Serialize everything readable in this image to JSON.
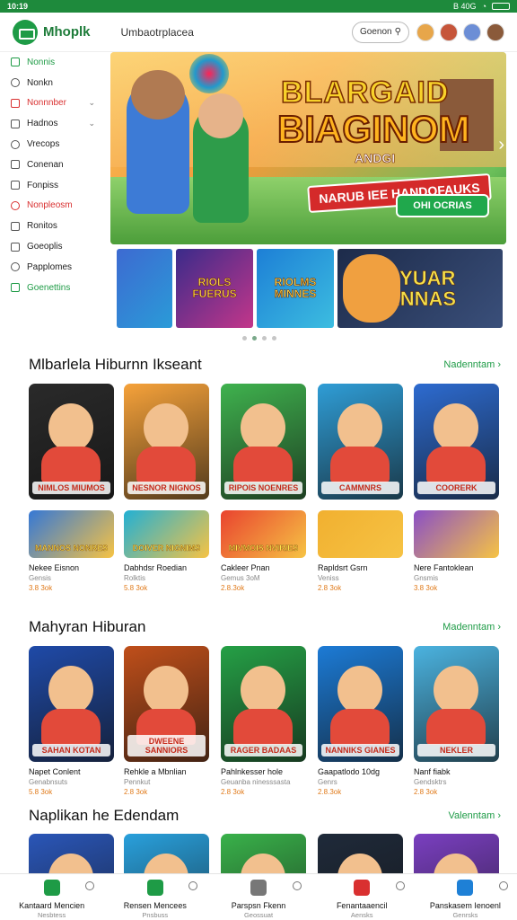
{
  "status_bar": {
    "time": "10:19",
    "right_text": "B 40G"
  },
  "header": {
    "app_name": "Mhoplk",
    "tagline": "Umbaotrplacea",
    "search_placeholder": "Goenon"
  },
  "sidebar": {
    "items": [
      {
        "label": "Nonnis",
        "style": "green",
        "icon": "grid-icon"
      },
      {
        "label": "Nonkn",
        "style": "normal",
        "icon": "calendar-icon"
      },
      {
        "label": "Nonnnber",
        "style": "red",
        "icon": "tag-icon",
        "chevron": true
      },
      {
        "label": "Hadnos",
        "style": "normal",
        "icon": "list-icon",
        "chevron": true
      },
      {
        "label": "Vrecops",
        "style": "normal",
        "icon": "doc-icon"
      },
      {
        "label": "Conenan",
        "style": "normal",
        "icon": "check-icon"
      },
      {
        "label": "Fonpiss",
        "style": "normal",
        "icon": "refresh-icon"
      },
      {
        "label": "Nonpleosm",
        "style": "red",
        "icon": "clock-icon"
      },
      {
        "label": "Ronitos",
        "style": "normal",
        "icon": "settings-icon"
      },
      {
        "label": "Goeoplis",
        "style": "normal",
        "icon": "globe-icon"
      },
      {
        "label": "Papplomes",
        "style": "normal",
        "icon": "message-icon"
      },
      {
        "label": "Goenettins",
        "style": "green",
        "icon": "file-icon"
      }
    ]
  },
  "hero": {
    "title_line1": "BLARGAID",
    "title_line2": "BIAGINOM",
    "title_line3": "ANDGI",
    "banner_text": "NARUB IEE HANDOFAUKS",
    "cta_label": "OHI OCRIAS"
  },
  "mini_banners": [
    "",
    "RIOLS FUERUS",
    "RIOLMS MINNES",
    "SHYUAR CANNAS"
  ],
  "sections": [
    {
      "title": "Mlbarlela Hiburnn Ikseant",
      "more_label": "Nadenntam",
      "cards": [
        {
          "big_label": "NIMLOS MIUMOS",
          "small_label": "MANNOS NONRES",
          "name": "Nekee Eisnon",
          "sub": "Gensis",
          "rating": "3.8 3ok",
          "big_color": "#2a2a2a",
          "small_color": "#3578d6"
        },
        {
          "big_label": "NESNOR NIGNOS",
          "small_label": "DOIVER NIGNIMS",
          "name": "Dabhdsr Roedian",
          "sub": "Rolktis",
          "rating": "5.8 3ok",
          "big_color": "#f6a23a",
          "small_color": "#22b0d4"
        },
        {
          "big_label": "RIPOIS NOENRES",
          "small_label": "MIVMOIS NVIRIES",
          "name": "Cakleer Pnan",
          "sub": "Gemus 3oM",
          "rating": "2.8.3ok",
          "big_color": "#3fb24e",
          "small_color": "#e9432f"
        },
        {
          "big_label": "CAMMNRS",
          "small_label": "",
          "name": "Rapldsrt Gsrn",
          "sub": "Veniss",
          "rating": "2.8 3ok",
          "big_color": "#2f9dd6",
          "small_color": "#f1b030"
        },
        {
          "big_label": "COORERK",
          "small_label": "",
          "name": "Nere Fantoklean",
          "sub": "Gnsmis",
          "rating": "3.8 3ok",
          "big_color": "#2d6bd0",
          "small_color": "#8a4fc6"
        }
      ]
    },
    {
      "title": "Mahyran Hiburan",
      "more_label": "Madenntam",
      "cards": [
        {
          "big_label": "SAHAN KOTAN",
          "name": "Napet Conlent",
          "sub": "Genabnsuts",
          "rating": "5.8 3ok",
          "big_color": "#1f4aa8"
        },
        {
          "big_label": "DWEENE SANNIORS",
          "name": "Rehkle a Mbnlian",
          "sub": "Pennkut",
          "rating": "2.8 3ok",
          "big_color": "#c04f1a"
        },
        {
          "big_label": "RAGER BADAAS",
          "name": "Pahlnkesser hole",
          "sub": "Geuanba ninesssasta",
          "rating": "2.8 3ok",
          "big_color": "#25a046"
        },
        {
          "big_label": "NANNIKS GIANES",
          "name": "Gaapatlodo 10dg",
          "sub": "Genrs",
          "rating": "2.8.3ok",
          "big_color": "#1c7bd6"
        },
        {
          "big_label": "NEKLER",
          "name": "Nanf fiabk",
          "sub": "Gendsktrs",
          "rating": "2.8 3ok",
          "big_color": "#4bb3e0"
        }
      ]
    },
    {
      "title": "Naplikan he Edendam",
      "more_label": "Valenntam",
      "cards": [
        {
          "big_color": "#2a56b8"
        },
        {
          "big_color": "#29a0dc"
        },
        {
          "big_color": "#39b14a"
        },
        {
          "big_color": "#1f2a3a"
        },
        {
          "big_color": "#7a3fc0"
        }
      ]
    }
  ],
  "bottom_nav": [
    {
      "label": "Kantaard Mencien",
      "sub": "Nesbtess",
      "icon": "home-icon",
      "color": "#1e9b46"
    },
    {
      "label": "Rensen Mencees",
      "sub": "Pnsbuss",
      "icon": "shield-icon",
      "color": "#1e9b46"
    },
    {
      "label": "Parspsn Fkenn",
      "sub": "Geossuat",
      "icon": "box-icon",
      "color": "#777777"
    },
    {
      "label": "Fenantaaencil",
      "sub": "Aensks",
      "icon": "target-icon",
      "color": "#d93030"
    },
    {
      "label": "Panskasem Ienoenl",
      "sub": "Genrsks",
      "icon": "star-icon",
      "color": "#1e80d6"
    }
  ]
}
